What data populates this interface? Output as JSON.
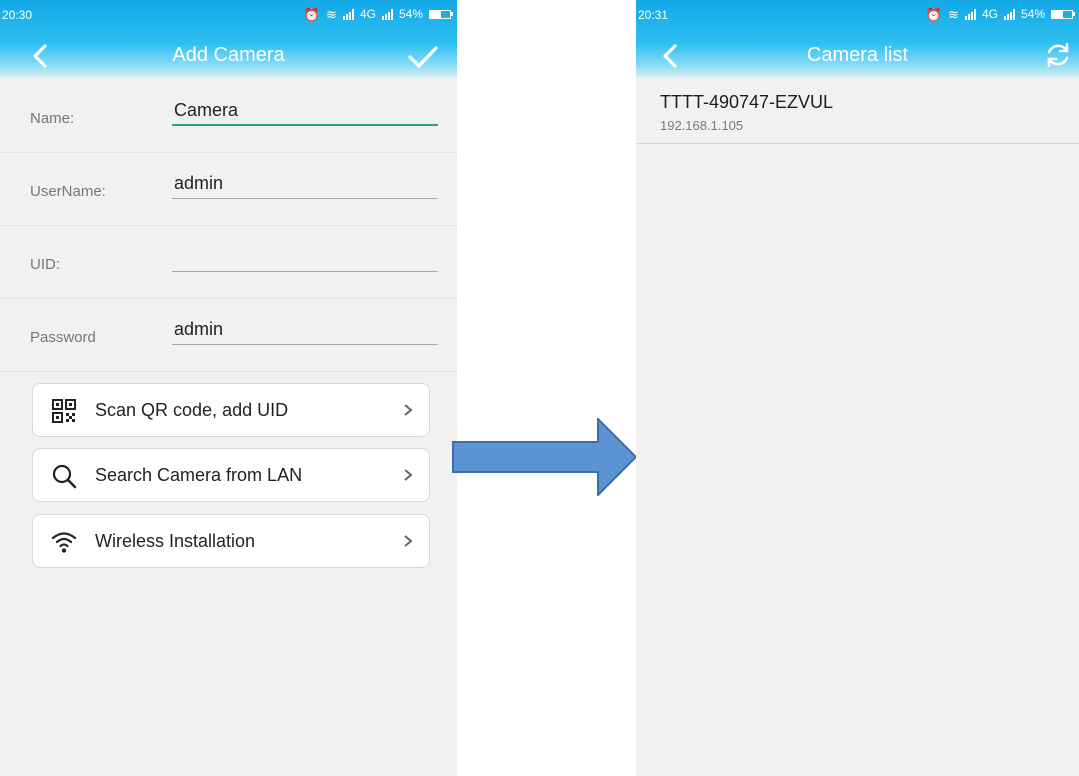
{
  "left_screen": {
    "status": {
      "time": "20:30",
      "network": "4G",
      "battery": "54%",
      "battery_level": 0.54
    },
    "header": {
      "title": "Add Camera"
    },
    "fields": [
      {
        "label": "Name:",
        "value": "Camera"
      },
      {
        "label": "UserName:",
        "value": "admin"
      },
      {
        "label": "UID:",
        "value": ""
      },
      {
        "label": "Password",
        "value": "admin"
      }
    ],
    "actions": [
      {
        "label": "Scan QR code, add UID",
        "icon": "qr-code-icon"
      },
      {
        "label": "Search Camera from LAN",
        "icon": "search-icon"
      },
      {
        "label": "Wireless Installation",
        "icon": "wifi-icon"
      }
    ]
  },
  "right_screen": {
    "status": {
      "time": "20:31",
      "network": "4G",
      "battery": "54%",
      "battery_level": 0.54
    },
    "header": {
      "title": "Camera list"
    },
    "devices": [
      {
        "name": "TTTT-490747-EZVUL",
        "ip": "192.168.1.105"
      }
    ]
  },
  "colors": {
    "header_blue": "#2fc0f1",
    "focus_underline": "#2aa38c",
    "arrow_fill": "#5b93d3",
    "arrow_stroke": "#3c6ea8"
  }
}
